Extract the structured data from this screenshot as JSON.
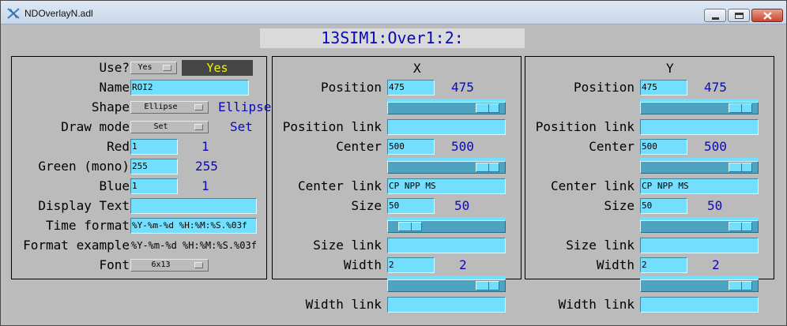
{
  "window": {
    "title": "NDOverlayN.adl"
  },
  "pv_title": "13SIM1:Over1:2:",
  "left": {
    "use_label": "Use?",
    "use_menu": "Yes",
    "use_readback": "Yes",
    "name_label": "Name",
    "name_value": "ROI2",
    "shape_label": "Shape",
    "shape_menu": "Ellipse",
    "shape_readback": "Ellipse",
    "draw_mode_label": "Draw mode",
    "draw_mode_menu": "Set",
    "draw_mode_readback": "Set",
    "red_label": "Red",
    "red_value": "1",
    "red_readback": "1",
    "green_label": "Green (mono)",
    "green_value": "255",
    "green_readback": "255",
    "blue_label": "Blue",
    "blue_value": "1",
    "blue_readback": "1",
    "display_text_label": "Display Text",
    "display_text_value": "",
    "time_format_label": "Time format",
    "time_format_value": "%Y-%m-%d %H:%M:%S.%03f",
    "format_example_label": "Format example",
    "format_example_value": "%Y-%m-%d %H:%M:%S.%03f",
    "font_label": "Font",
    "font_menu": "6x13"
  },
  "x": {
    "header": "X",
    "position_label": "Position",
    "position_value": "475",
    "position_readback": "475",
    "position_link_label": "Position link",
    "position_link_value": "",
    "center_label": "Center",
    "center_value": "500",
    "center_readback": "500",
    "center_link_label": "Center link",
    "center_link_value": "CP NPP MS",
    "size_label": "Size",
    "size_value": "50",
    "size_readback": "50",
    "size_link_label": "Size link",
    "size_link_value": "",
    "width_label": "Width",
    "width_value": "2",
    "width_readback": "2",
    "width_link_label": "Width link",
    "width_link_value": ""
  },
  "y": {
    "header": "Y",
    "position_label": "Position",
    "position_value": "475",
    "position_readback": "475",
    "position_link_label": "Position link",
    "position_link_value": "",
    "center_label": "Center",
    "center_value": "500",
    "center_readback": "500",
    "center_link_label": "Center link",
    "center_link_value": "CP NPP MS",
    "size_label": "Size",
    "size_value": "50",
    "size_readback": "50",
    "size_link_label": "Size link",
    "size_link_value": "",
    "width_label": "Width",
    "width_value": "2",
    "width_readback": "2",
    "width_link_label": "Width link",
    "width_link_value": ""
  },
  "sliders": {
    "x_position": 0.95,
    "x_center": 0.95,
    "x_size": 0.1,
    "x_width": 0.95,
    "y_position": 0.95,
    "y_center": 0.95,
    "y_size": 0.95,
    "y_width": 0.95
  },
  "colors": {
    "input_bg": "#73dfff",
    "readback": "#0a0ab4",
    "yes_fg": "#f2f20c",
    "yes_bg": "#464646"
  }
}
